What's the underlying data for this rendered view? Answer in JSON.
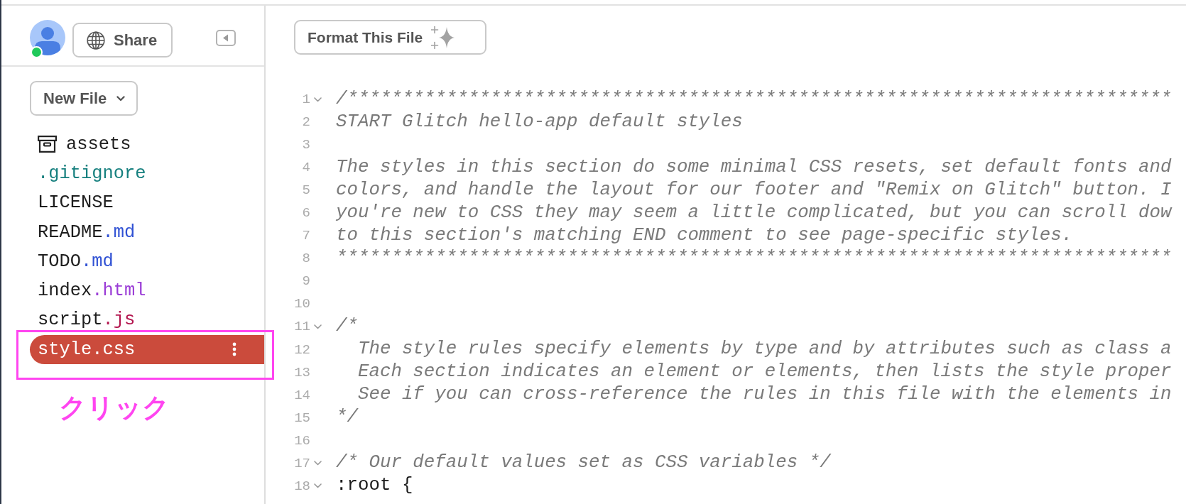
{
  "sidebar": {
    "user": {
      "online": true
    },
    "share_button": {
      "label": "Share"
    },
    "new_file_button": {
      "label": "New File"
    },
    "files": [
      {
        "kind": "folder",
        "stem": "assets",
        "selected": false,
        "highlighted": false
      },
      {
        "kind": "file",
        "ext": ".gitignore",
        "color": "#17807f",
        "selected": false,
        "highlighted": false
      },
      {
        "kind": "file",
        "stem": "LICENSE",
        "selected": false,
        "highlighted": false
      },
      {
        "kind": "file",
        "stem": "README",
        "ext": ".md",
        "color": "#3152d4",
        "selected": false,
        "highlighted": false
      },
      {
        "kind": "file",
        "stem": "TODO",
        "ext": ".md",
        "color": "#3152d4",
        "selected": false,
        "highlighted": false
      },
      {
        "kind": "file",
        "stem": "index",
        "ext": ".html",
        "color": "#9a3cd6",
        "selected": false,
        "highlighted": false
      },
      {
        "kind": "file",
        "stem": "script",
        "ext": ".js",
        "color": "#b3154e",
        "selected": false,
        "highlighted": false
      },
      {
        "kind": "file",
        "stem": "style",
        "ext": ".css",
        "selected": true,
        "highlighted": true
      }
    ],
    "annotation": {
      "text": "クリック"
    }
  },
  "editor": {
    "format_button": {
      "label": "Format This File"
    },
    "lines": [
      {
        "number": "1",
        "kind": "comment",
        "foldable": true,
        "text": "/***************************************************************************"
      },
      {
        "number": "2",
        "kind": "comment",
        "foldable": false,
        "text": "START Glitch hello-app default styles"
      },
      {
        "number": "3",
        "foldable": false
      },
      {
        "number": "4",
        "kind": "comment",
        "foldable": false,
        "text": "The styles in this section do some minimal CSS resets, set default fonts and"
      },
      {
        "number": "5",
        "kind": "comment",
        "foldable": false,
        "text": "colors, and handle the layout for our footer and \"Remix on Glitch\" button. I"
      },
      {
        "number": "6",
        "kind": "comment",
        "foldable": false,
        "text": "you're new to CSS they may seem a little complicated, but you can scroll dow"
      },
      {
        "number": "7",
        "kind": "comment",
        "foldable": false,
        "text": "to this section's matching END comment to see page-specific styles."
      },
      {
        "number": "8",
        "kind": "comment",
        "foldable": false,
        "text": "****************************************************************************"
      },
      {
        "number": "9",
        "foldable": false
      },
      {
        "number": "10",
        "foldable": false
      },
      {
        "number": "11",
        "kind": "comment",
        "foldable": true,
        "text": "/*"
      },
      {
        "number": "12",
        "kind": "comment",
        "foldable": false,
        "text": "  The style rules specify elements by type and by attributes such as class a"
      },
      {
        "number": "13",
        "kind": "comment",
        "foldable": false,
        "text": "  Each section indicates an element or elements, then lists the style proper"
      },
      {
        "number": "14",
        "kind": "comment",
        "foldable": false,
        "text": "  See if you can cross-reference the rules in this file with the elements in"
      },
      {
        "number": "15",
        "kind": "comment",
        "foldable": false,
        "text": "*/"
      },
      {
        "number": "16",
        "foldable": false
      },
      {
        "number": "17",
        "kind": "comment",
        "foldable": true,
        "text": "/* Our default values set as CSS variables */"
      },
      {
        "number": "18",
        "kind": "code",
        "foldable": true,
        "text": ":root {"
      }
    ]
  }
}
